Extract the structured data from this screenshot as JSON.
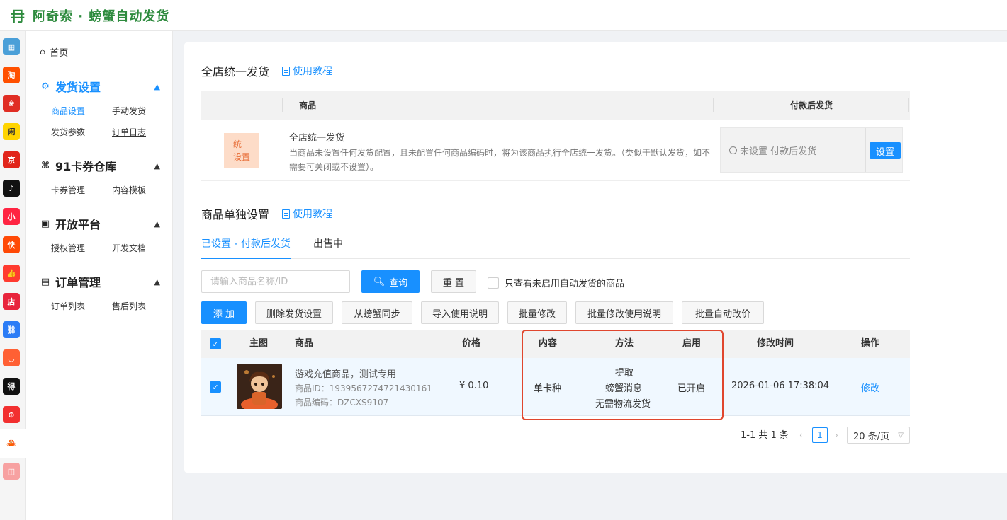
{
  "header": {
    "logo_glyph": "冄",
    "title": "阿奇索 · 螃蟹自动发货"
  },
  "rail": {
    "items": [
      {
        "name": "qr-platform-icon",
        "glyph": "▦",
        "bg": "#4a9fd8"
      },
      {
        "name": "taobao-icon",
        "glyph": "淘",
        "bg": "#ff5000"
      },
      {
        "name": "pinduoduo-icon",
        "glyph": "❀",
        "bg": "#e02e24"
      },
      {
        "name": "weidian-icon",
        "glyph": "闲",
        "bg": "#ffd400"
      },
      {
        "name": "jd-icon",
        "glyph": "京",
        "bg": "#e1251b"
      },
      {
        "name": "douyin-icon",
        "glyph": "♪",
        "bg": "#111111"
      },
      {
        "name": "xiaohongshu-icon",
        "glyph": "小",
        "bg": "#ff2442"
      },
      {
        "name": "kuaishou-icon",
        "glyph": "快",
        "bg": "#ff4906"
      },
      {
        "name": "thumbsup-icon",
        "glyph": "👍",
        "bg": "#ff3b30"
      },
      {
        "name": "store-icon",
        "glyph": "店",
        "bg": "#e8243c"
      },
      {
        "name": "link-icon",
        "glyph": "⛓",
        "bg": "#2b7cf6"
      },
      {
        "name": "shop-icon",
        "glyph": "◡",
        "bg": "#ff6034"
      },
      {
        "name": "dewu-icon",
        "glyph": "得",
        "bg": "#111111"
      },
      {
        "name": "youzan-icon",
        "glyph": "⊕",
        "bg": "#f23030"
      },
      {
        "name": "crab-icon",
        "glyph": "🦀",
        "bg": "#ffffff"
      },
      {
        "name": "shopping-bag-icon",
        "glyph": "◫",
        "bg": "#f7a1a1"
      }
    ]
  },
  "sidebar": {
    "home": "首页",
    "groups": [
      {
        "title": "发货设置",
        "items": [
          "商品设置",
          "手动发货",
          "发货参数",
          "订单日志"
        ]
      },
      {
        "title": "91卡券仓库",
        "items": [
          "卡券管理",
          "内容模板"
        ]
      },
      {
        "title": "开放平台",
        "items": [
          "授权管理",
          "开发文档"
        ]
      },
      {
        "title": "订单管理",
        "items": [
          "订单列表",
          "售后列表"
        ]
      }
    ]
  },
  "store_section": {
    "title": "全店统一发货",
    "tutorial": "使用教程",
    "columns": [
      "商品",
      "付款后发货"
    ],
    "badge": "统一设置",
    "badge_line1": "统一",
    "badge_line2": "设置",
    "name": "全店统一发货",
    "description": "当商品未设置任何发货配置，且未配置任何商品编码时，将为该商品执行全店统一发货。（类似于默认发货，如不需要可关闭或不设置）。",
    "after_pay_status": "未设置 付款后发货",
    "set_button": "设置"
  },
  "product_section": {
    "title": "商品单独设置",
    "tutorial": "使用教程",
    "tabs": [
      "已设置 - 付款后发货",
      "出售中"
    ],
    "search_placeholder": "请输入商品名称/ID",
    "query_button": "查询",
    "reset_button": "重 置",
    "only_disabled_label": "只查看未启用自动发货的商品",
    "actions": [
      "添 加",
      "删除发货设置",
      "从螃蟹同步",
      "导入使用说明",
      "批量修改",
      "批量修改使用说明",
      "批量自动改价"
    ]
  },
  "product_table": {
    "columns": [
      "主图",
      "商品",
      "价格",
      "内容",
      "方法",
      "启用",
      "修改时间",
      "操作"
    ],
    "rows": [
      {
        "title": "游戏充值商品，测试专用",
        "id_line": "商品ID：1939567274721430161",
        "code_line": "商品编码：DZCXS9107",
        "price": "¥ 0.10",
        "content": "单卡种",
        "method_1": "提取",
        "method_2": "螃蟹消息",
        "method_3": "无需物流发货",
        "enabled": "已开启",
        "modified": "2026-01-06 17:38:04",
        "action": "修改"
      }
    ]
  },
  "pagination": {
    "summary": "1-1 共 1 条",
    "current_page": "1",
    "page_size": "20 条/页"
  },
  "colors": {
    "brand_green": "#2e8b3e",
    "primary": "#1890ff",
    "highlight_red": "#e0462e"
  }
}
